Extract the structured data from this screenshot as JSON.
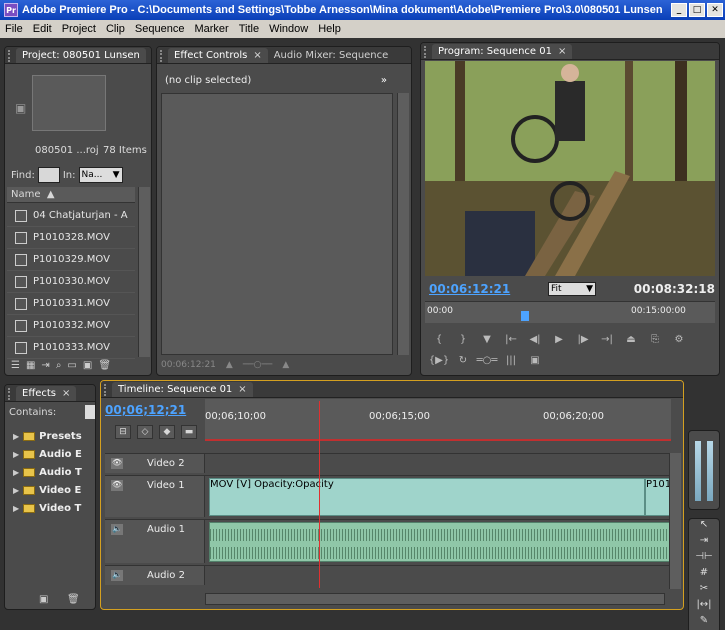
{
  "window": {
    "title": "Adobe Premiere Pro - C:\\Documents and Settings\\Tobbe Arnesson\\Mina dokument\\Adobe\\Premiere Pro\\3.0\\080501 Lunsen",
    "app_icon": "Pr"
  },
  "menu": [
    "File",
    "Edit",
    "Project",
    "Clip",
    "Sequence",
    "Marker",
    "Title",
    "Window",
    "Help"
  ],
  "project": {
    "tab": "Project: 080501 Lunsen",
    "name": "080501 ...roj",
    "count": "78 Items",
    "find_label": "Find:",
    "in_label": "In:",
    "in_value": "Na...",
    "column": "Name",
    "items": [
      "04 Chatjaturjan - A",
      "P1010328.MOV",
      "P1010329.MOV",
      "P1010330.MOV",
      "P1010331.MOV",
      "P1010332.MOV",
      "P1010333.MOV"
    ]
  },
  "effect_controls": {
    "tab": "Effect Controls",
    "tab2": "Audio Mixer: Sequence",
    "no_clip": "(no clip selected)",
    "footer_tc": "00:06:12:21"
  },
  "program": {
    "tab": "Program: Sequence 01",
    "current_tc": "00:06:12:21",
    "fit": "Fit",
    "duration": "00:08:32:18",
    "ruler_start": "00:00",
    "ruler_mark": "00:15:00:00"
  },
  "effects": {
    "tab": "Effects",
    "contains": "Contains:",
    "items": [
      "Presets",
      "Audio E",
      "Audio T",
      "Video E",
      "Video T"
    ]
  },
  "timeline": {
    "tab": "Timeline: Sequence 01",
    "current_tc": "00;06;12;21",
    "ruler": [
      "00;06;10;00",
      "00;06;15;00",
      "00;06;20;00"
    ],
    "tracks": {
      "video2": "Video 2",
      "video1": "Video 1",
      "audio1": "Audio 1",
      "audio2": "Audio 2"
    },
    "clip_label": "MOV [V]  Opacity:Opacity",
    "clip_right": "P101"
  }
}
